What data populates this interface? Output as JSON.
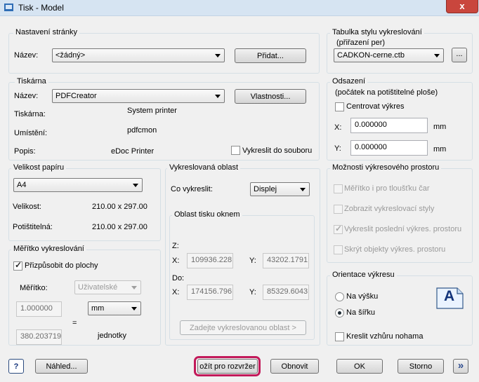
{
  "window": {
    "title": "Tisk -   Model",
    "close_symbol": "x"
  },
  "page_setup": {
    "group_label": "Nastavení stránky",
    "name_label": "Název:",
    "name_value": "<žádný>",
    "add_button": "Přidat..."
  },
  "printer": {
    "group_label": "Tiskárna",
    "name_label": "Název:",
    "name_value": "PDFCreator",
    "properties_button": "Vlastnosti...",
    "printer_label": "Tiskárna:",
    "printer_value": "System printer",
    "location_label": "Umístění:",
    "location_value": "pdfcmon",
    "description_label": "Popis:",
    "description_value": "eDoc Printer",
    "print_to_file_label": "Vykreslit do souboru"
  },
  "plot_style_table": {
    "group_label": "Tabulka stylu vykreslování",
    "group_label_2": "(přiřazení per)",
    "value": "CADKON-cerne.ctb",
    "edit_button": "..."
  },
  "plot_offset": {
    "group_label": "Odsazení",
    "group_label_2": "(počátek na potištitelné ploše)",
    "center_label": "Centrovat výkres",
    "x_label": "X:",
    "x_value": "0.000000",
    "x_unit": "mm",
    "y_label": "Y:",
    "y_value": "0.000000",
    "y_unit": "mm"
  },
  "paper_size": {
    "group_label": "Velikost papíru",
    "value": "A4",
    "size_label": "Velikost:",
    "size_value": "210.00 x 297.00",
    "printable_label": "Potištitelná:",
    "printable_value": "210.00 x 297.00"
  },
  "plot_area": {
    "group_label": "Vykreslovaná oblast",
    "what_label": "Co vykreslit:",
    "what_value": "Displej",
    "window_group_label": "Oblast tisku oknem",
    "from_label": "Z:",
    "from_x_label": "X:",
    "from_x_value": "109936.228",
    "from_y_label": "Y:",
    "from_y_value": "43202.1791",
    "to_label": "Do:",
    "to_x_label": "X:",
    "to_x_value": "174156.796",
    "to_y_label": "Y:",
    "to_y_value": "85329.6043",
    "pick_button": "Zadejte vykreslovanou oblast >"
  },
  "plot_scale": {
    "group_label": "Měřítko vykreslování",
    "fit_label": "Přizpůsobit do plochy",
    "scale_label": "Měřítko:",
    "scale_value": "Uživatelské",
    "value1": "1.000000",
    "unit_value": "mm",
    "equals": "=",
    "value2": "380.203719",
    "unit2": "jednotky"
  },
  "shaded_viewport": {
    "group_label": "Možnosti výkresového prostoru",
    "opt1": "Měřítko i pro tloušťku čar",
    "opt2": "Zobrazit vykreslovací styly",
    "opt3": "Vykreslit poslední výkres. prostoru",
    "opt4": "Skrýt objekty výkres. prostoru"
  },
  "orientation": {
    "group_label": "Orientace výkresu",
    "portrait": "Na výšku",
    "landscape": "Na šířku",
    "upside_down": "Kreslit vzhůru nohama",
    "preview_letter": "A"
  },
  "footer": {
    "help": "?",
    "preview": "Náhled...",
    "apply_to_layout": "ožít pro rozvržer",
    "refresh": "Obnovit",
    "ok": "OK",
    "cancel": "Storno",
    "expand": "»"
  }
}
